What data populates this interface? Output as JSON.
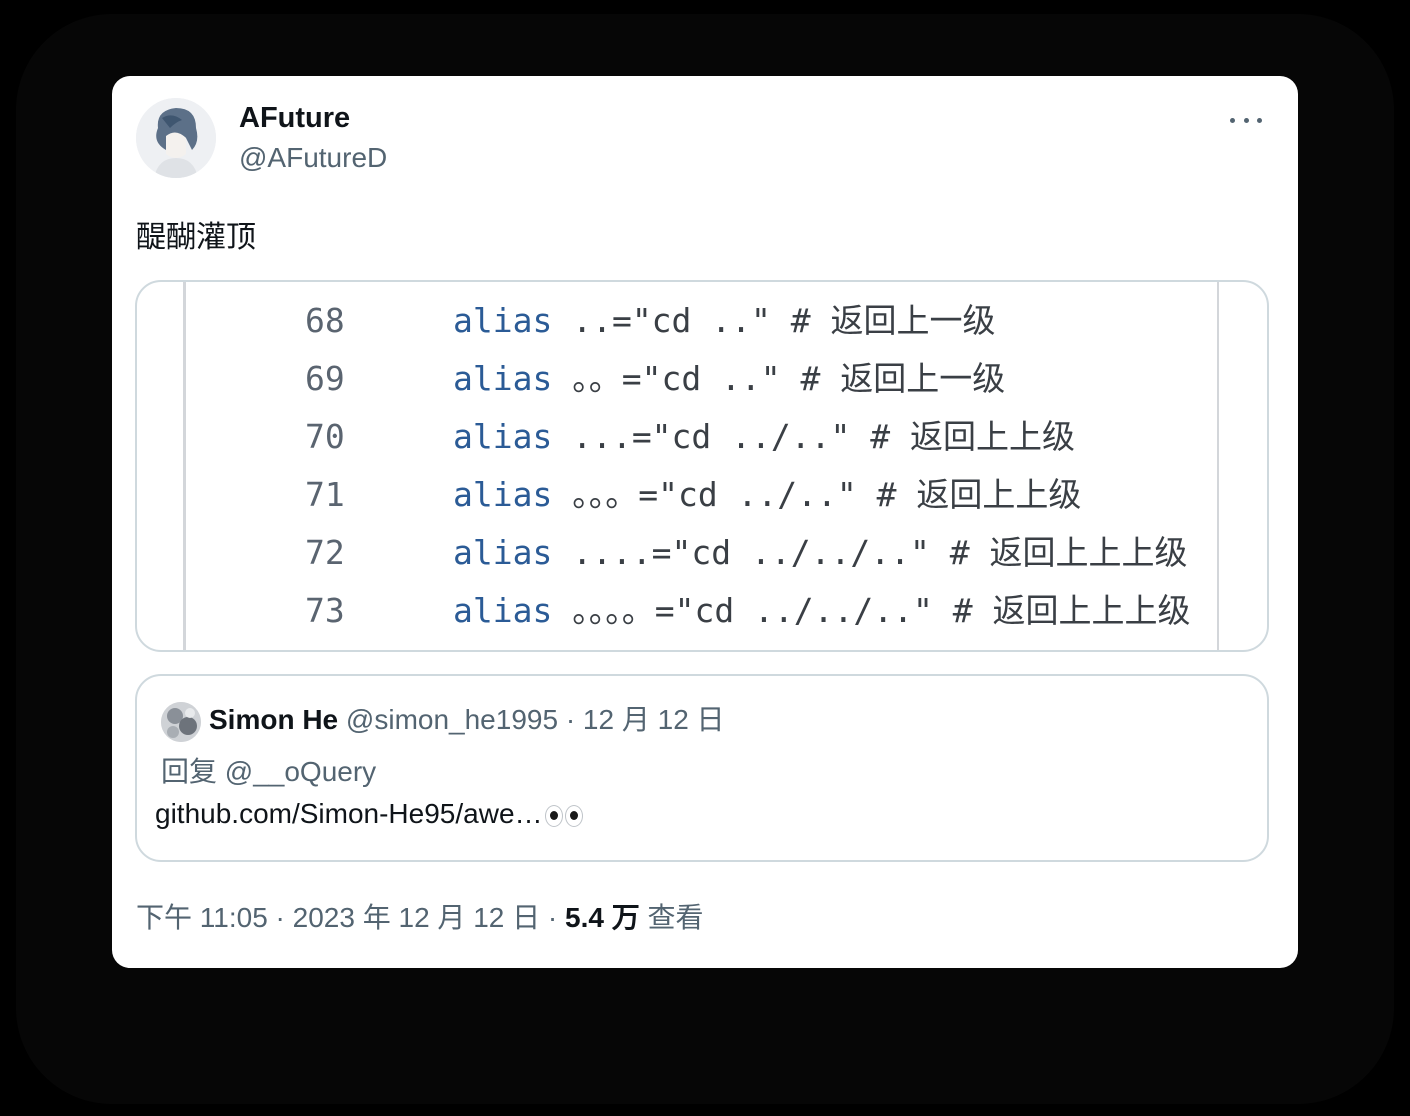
{
  "tweet": {
    "author": {
      "display_name": "AFuture",
      "handle": "@AFutureD"
    },
    "text": "醍醐灌顶",
    "code_image": {
      "lines": [
        {
          "num": "68",
          "kw": "alias",
          "rest": " ..=\"cd ..\" ",
          "comment": "# 返回上一级"
        },
        {
          "num": "69",
          "kw": "alias",
          "rest": " 。。=\"cd ..\" ",
          "comment": "# 返回上一级"
        },
        {
          "num": "70",
          "kw": "alias",
          "rest": " ...=\"cd ../..\" ",
          "comment": "# 返回上上级"
        },
        {
          "num": "71",
          "kw": "alias",
          "rest": " 。。。=\"cd ../..\" ",
          "comment": "# 返回上上级"
        },
        {
          "num": "72",
          "kw": "alias",
          "rest": " ....=\"cd ../../..\" ",
          "comment": "# 返回上上上级"
        },
        {
          "num": "73",
          "kw": "alias",
          "rest": " 。。。。=\"cd ../../..\" ",
          "comment": "# 返回上上上级"
        }
      ]
    },
    "quoted": {
      "display_name": "Simon He",
      "meta": " @simon_he1995 · 12 月 12 日",
      "reply": "回复 @__oQuery",
      "text": "github.com/Simon-He95/awe…",
      "emoji": "eyes"
    },
    "footer": {
      "time": "下午 11:05 · 2023 年 12 月 12 日 · ",
      "views_count": "5.4 万",
      "views_label": " 查看"
    }
  }
}
